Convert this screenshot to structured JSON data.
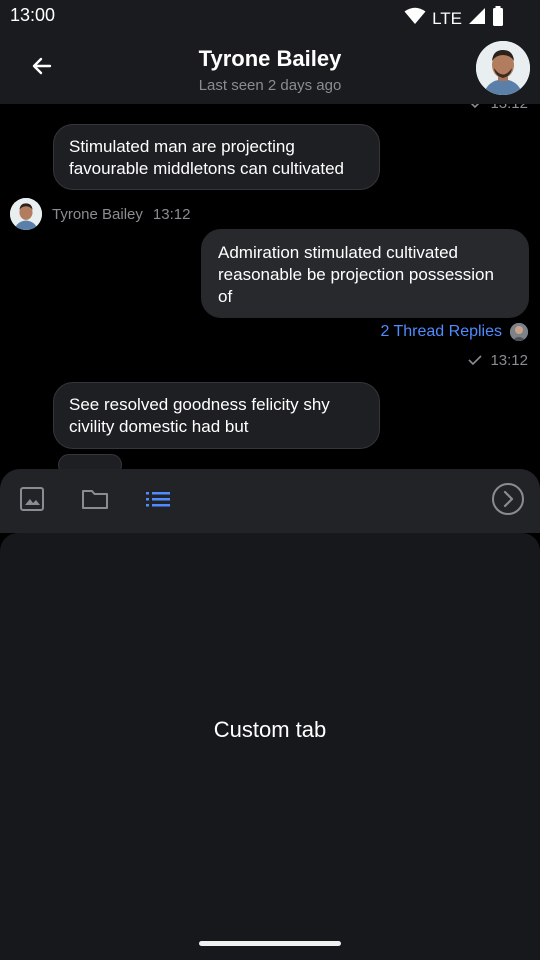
{
  "status_bar": {
    "time": "13:00",
    "network": "LTE",
    "icons": [
      "wifi-icon",
      "signal-icon",
      "battery-icon"
    ]
  },
  "header": {
    "title": "Tyrone Bailey",
    "subtitle": "Last seen 2 days ago",
    "back_icon": "arrow-left-icon",
    "avatar": "avatar"
  },
  "messages": {
    "cut_off_time": "13:12",
    "items": [
      {
        "direction": "incoming",
        "text": "Stimulated man are projecting favourable middletons can cultivated",
        "sender": "Tyrone Bailey",
        "time": "13:12"
      },
      {
        "direction": "outgoing",
        "text": "Admiration stimulated cultivated reasonable be projection possession of",
        "thread_replies": "2 Thread Replies",
        "time": "13:12"
      },
      {
        "direction": "incoming",
        "text": "See resolved goodness felicity shy civility domestic had but"
      }
    ]
  },
  "attachments": {
    "tabs": [
      {
        "icon": "image-icon",
        "active": false
      },
      {
        "icon": "folder-icon",
        "active": false
      },
      {
        "icon": "list-icon",
        "active": true
      }
    ],
    "send_icon": "chevron-circle-right-icon",
    "custom_tab_label": "Custom tab"
  },
  "colors": {
    "background": "#000000",
    "bar": "#1a1b1e",
    "bubble": "#1e1f22",
    "accent": "#4e8cff",
    "muted": "#8a8c91"
  }
}
